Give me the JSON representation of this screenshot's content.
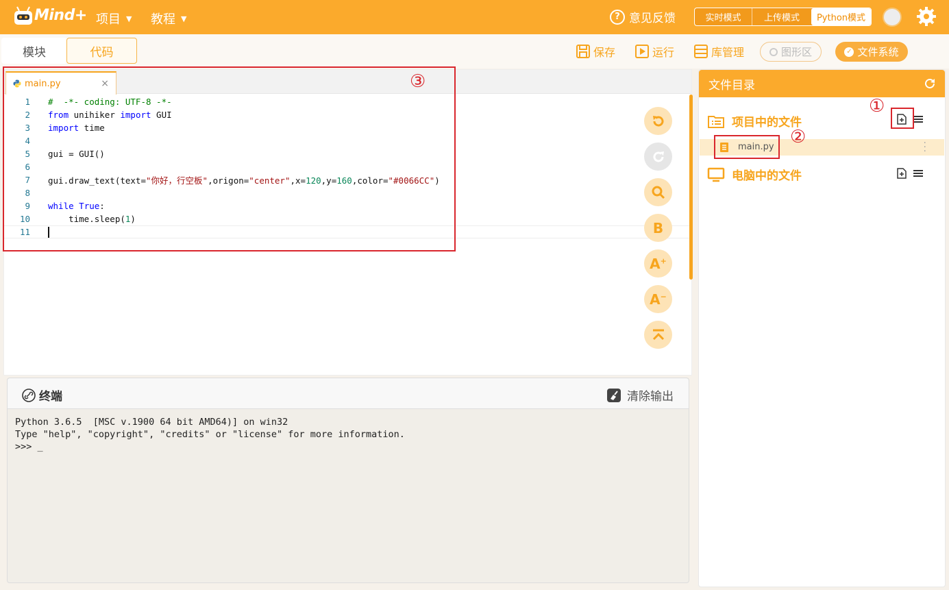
{
  "header": {
    "logo_text": "Mind+",
    "menu_project": "项目",
    "menu_tutorial": "教程",
    "feedback": "意见反馈",
    "modes": [
      "实时模式",
      "上传模式",
      "Python模式"
    ],
    "active_mode": "Python模式"
  },
  "tabs": {
    "blocks": "模块",
    "code": "代码"
  },
  "toolbar": {
    "save": "保存",
    "run": "运行",
    "library": "库管理",
    "graph_area": "图形区",
    "file_system": "文件系统"
  },
  "editor": {
    "tab_name": "main.py",
    "close_glyph": "×",
    "line_numbers": [
      "1",
      "2",
      "3",
      "4",
      "5",
      "6",
      "7",
      "8",
      "9",
      "10",
      "11"
    ]
  },
  "code_lines": {
    "l1": "#  -*- coding: UTF-8 -*-",
    "l2_kw1": "from",
    "l2_mid": " unihiker ",
    "l2_kw2": "import",
    "l2_end": " GUI",
    "l3_kw": "import",
    "l3_end": " time",
    "l5": "gui = GUI()",
    "l7_a": "gui.draw_text(text=",
    "l7_s1": "\"你好，行空板\"",
    "l7_b": ",origon=",
    "l7_s2": "\"center\"",
    "l7_c": ",x=",
    "l7_n1": "120",
    "l7_d": ",y=",
    "l7_n2": "160",
    "l7_e": ",color=",
    "l7_s3": "\"#0066CC\"",
    "l7_f": ")",
    "l9_kw": "while",
    "l9_kw2": " True",
    "l9_end": ":",
    "l10_a": "    time.sleep(",
    "l10_n": "1",
    "l10_b": ")"
  },
  "terminal": {
    "title": "终端",
    "clear": "清除输出",
    "output": "Python 3.6.5  [MSC v.1900 64 bit AMD64)] on win32\nType \"help\", \"copyright\", \"credits\" or \"license\" for more information.\n>>> _"
  },
  "file_panel": {
    "title": "文件目录",
    "project_files": "项目中的文件",
    "project_file_name": "main.py",
    "computer_files": "电脑中的文件"
  },
  "annotations": {
    "a1": "①",
    "a2": "②",
    "a3": "③"
  },
  "colors": {
    "accent": "#fbaa2c",
    "annotation_red": "#d9262c"
  }
}
